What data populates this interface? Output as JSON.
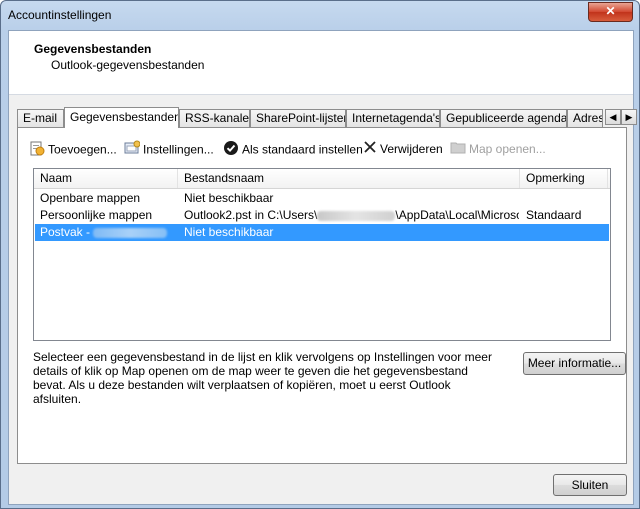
{
  "window": {
    "title": "Accountinstellingen",
    "close_label": "✕"
  },
  "header": {
    "title": "Gegevensbestanden",
    "subtitle": "Outlook-gegevensbestanden"
  },
  "tabs": [
    {
      "label": "E-mail"
    },
    {
      "label": "Gegevensbestanden"
    },
    {
      "label": "RSS-kanalen"
    },
    {
      "label": "SharePoint-lijsten"
    },
    {
      "label": "Internetagenda's"
    },
    {
      "label": "Gepubliceerde agenda's"
    },
    {
      "label": "Adres"
    }
  ],
  "active_tab": "Gegevensbestanden",
  "tab_scroll": {
    "left": "◀",
    "right": "▶"
  },
  "toolbar": {
    "add": "Toevoegen...",
    "settings": "Instellingen...",
    "set_default": "Als standaard instellen",
    "remove": "Verwijderen",
    "open_folder": "Map openen..."
  },
  "list": {
    "columns": [
      "Naam",
      "Bestandsnaam",
      "Opmerking"
    ],
    "rows": [
      {
        "name": "Openbare mappen",
        "file": "Niet beschikbaar",
        "note": ""
      },
      {
        "name": "Persoonlijke mappen",
        "file_prefix": "Outlook2.pst in C:\\Users\\",
        "file_suffix": "\\AppData\\Local\\Microsoft...",
        "note": "Standaard"
      },
      {
        "name": "Postvak -",
        "file": "Niet beschikbaar",
        "note": "",
        "selected": true
      }
    ]
  },
  "description": "Selecteer een gegevensbestand in de lijst en klik vervolgens op Instellingen voor meer details of klik op Map openen om de map weer te geven die het gegevensbestand bevat. Als u deze bestanden wilt verplaatsen of kopiëren, moet u eerst Outlook afsluiten.",
  "buttons": {
    "more_info": "Meer informatie...",
    "close": "Sluiten"
  },
  "colors": {
    "selection": "#3399ff",
    "title_bar": "#c6d9ef",
    "close_button": "#c1331b"
  }
}
